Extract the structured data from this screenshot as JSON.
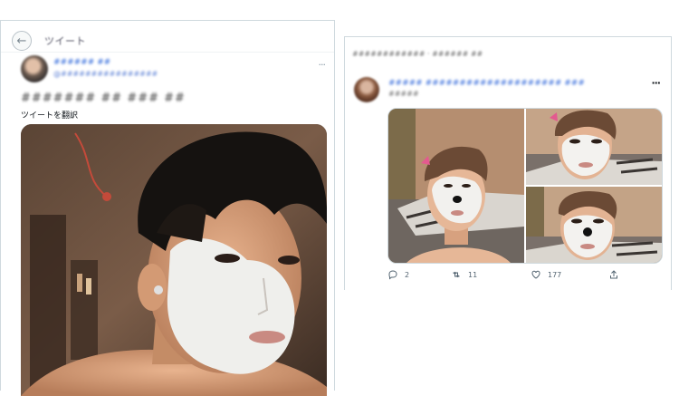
{
  "left_tweet": {
    "header_title": "ツイート",
    "author_name": "###### ##",
    "author_handle": "@################",
    "tweet_text": "####### ## ### ##",
    "translate_label": "ツイートを翻訳"
  },
  "right_tweet": {
    "retweet_note": "############ · ###### ##",
    "author_name": "##### #################### ###",
    "author_handle": "#####",
    "actions": {
      "replies": "2",
      "retweets": "11",
      "likes": "177"
    }
  },
  "icons": {
    "back": "back-arrow-icon",
    "more": "more-dots-icon",
    "reply": "reply-icon",
    "retweet": "retweet-icon",
    "like": "heart-icon",
    "share": "share-icon"
  },
  "colors": {
    "link": "#1d5bd8",
    "muted": "#536471",
    "border": "#cfd9de"
  }
}
